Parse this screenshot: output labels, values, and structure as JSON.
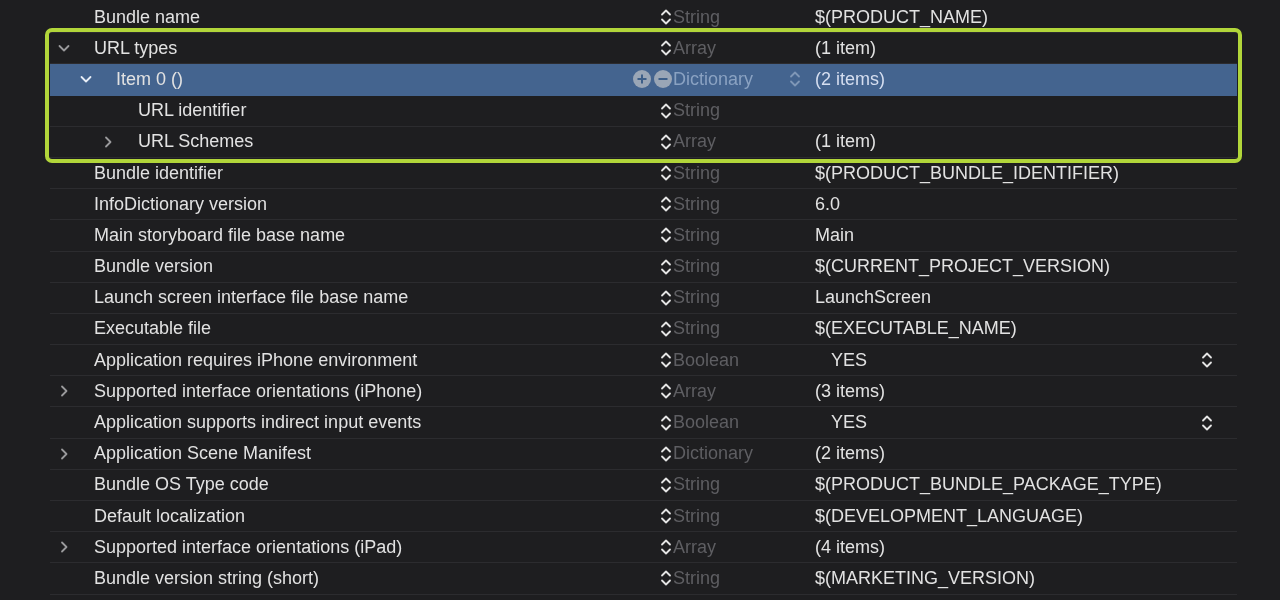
{
  "rows": [
    {
      "key": "Bundle name",
      "type": "String",
      "value": "$(PRODUCT_NAME)",
      "selected": false
    },
    {
      "key": "URL types",
      "type": "Array",
      "value": "(1 item)",
      "selected": false,
      "expanded": true,
      "highlighted": true,
      "children": [
        {
          "key": "Item 0 ()",
          "type": "Dictionary",
          "value": "(2 items)",
          "selected": true,
          "expanded": true,
          "children": [
            {
              "key": "URL identifier",
              "type": "String",
              "selected": false
            },
            {
              "key": "URL Schemes",
              "type": "Array",
              "value": "(1 item)",
              "selected": false,
              "expanded": false
            }
          ]
        }
      ]
    },
    {
      "key": "Bundle identifier",
      "type": "String",
      "value": "$(PRODUCT_BUNDLE_IDENTIFIER)",
      "selected": false
    },
    {
      "key": "InfoDictionary version",
      "type": "String",
      "value": "6.0",
      "selected": false
    },
    {
      "key": "Main storyboard file base name",
      "type": "String",
      "value": "Main",
      "selected": false
    },
    {
      "key": "Bundle version",
      "type": "String",
      "value": "$(CURRENT_PROJECT_VERSION)",
      "selected": false
    },
    {
      "key": "Launch screen interface file base name",
      "type": "String",
      "value": "LaunchScreen",
      "selected": false
    },
    {
      "key": "Executable file",
      "type": "String",
      "value": "$(EXECUTABLE_NAME)",
      "selected": false
    },
    {
      "key": "Application requires iPhone environment",
      "type": "Boolean",
      "value": "YES",
      "kind": "boolean",
      "selected": false
    },
    {
      "key": "Supported interface orientations (iPhone)",
      "type": "Array",
      "value": "(3 items)",
      "selected": false,
      "expanded": false
    },
    {
      "key": "Application supports indirect input events",
      "type": "Boolean",
      "value": "YES",
      "kind": "boolean",
      "selected": false
    },
    {
      "key": "Application Scene Manifest",
      "type": "Dictionary",
      "value": "(2 items)",
      "selected": false,
      "expanded": false
    },
    {
      "key": "Bundle OS Type code",
      "type": "String",
      "value": "$(PRODUCT_BUNDLE_PACKAGE_TYPE)",
      "selected": false
    },
    {
      "key": "Default localization",
      "type": "String",
      "value": "$(DEVELOPMENT_LANGUAGE)",
      "selected": false
    },
    {
      "key": "Supported interface orientations (iPad)",
      "type": "Array",
      "value": "(4 items)",
      "selected": false,
      "expanded": false
    },
    {
      "key": "Bundle version string (short)",
      "type": "String",
      "value": "$(MARKETING_VERSION)",
      "selected": false
    }
  ]
}
